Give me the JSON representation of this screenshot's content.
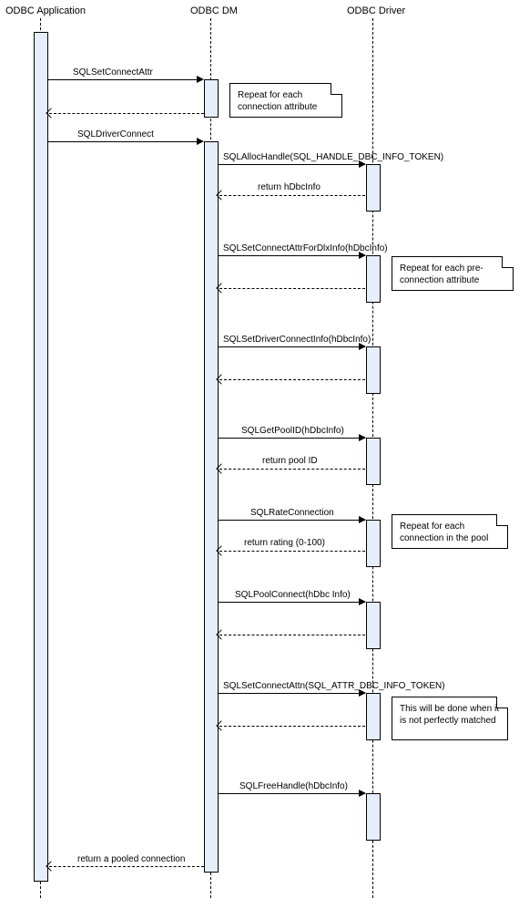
{
  "chart_data": {
    "type": "sequence_diagram",
    "participants": [
      "ODBC Application",
      "ODBC DM",
      "ODBC Driver"
    ],
    "messages": [
      {
        "from": "ODBC Application",
        "to": "ODBC DM",
        "label": "SQLSetConnectAttr",
        "kind": "sync",
        "note": "Repeat for each connection attribute"
      },
      {
        "from": "ODBC DM",
        "to": "ODBC Application",
        "label": "",
        "kind": "return"
      },
      {
        "from": "ODBC Application",
        "to": "ODBC DM",
        "label": "SQLDriverConnect",
        "kind": "sync"
      },
      {
        "from": "ODBC DM",
        "to": "ODBC Driver",
        "label": "SQLAllocHandle(SQL_HANDLE_DBC_INFO_TOKEN)",
        "kind": "sync"
      },
      {
        "from": "ODBC Driver",
        "to": "ODBC DM",
        "label": "return hDbcInfo",
        "kind": "return"
      },
      {
        "from": "ODBC DM",
        "to": "ODBC Driver",
        "label": "SQLSetConnectAttrForDlxInfo(hDbcInfo)",
        "kind": "sync",
        "note": "Repeat for each pre- connection attribute"
      },
      {
        "from": "ODBC Driver",
        "to": "ODBC DM",
        "label": "",
        "kind": "return"
      },
      {
        "from": "ODBC DM",
        "to": "ODBC Driver",
        "label": "SQLSetDriverConnectInfo(hDbcInfo)",
        "kind": "sync"
      },
      {
        "from": "ODBC Driver",
        "to": "ODBC DM",
        "label": "",
        "kind": "return"
      },
      {
        "from": "ODBC DM",
        "to": "ODBC Driver",
        "label": "SQLGetPoolID(hDbcInfo)",
        "kind": "sync"
      },
      {
        "from": "ODBC Driver",
        "to": "ODBC DM",
        "label": "return pool ID",
        "kind": "return"
      },
      {
        "from": "ODBC DM",
        "to": "ODBC Driver",
        "label": "SQLRateConnection",
        "kind": "sync",
        "note": "Repeat for each connection in the pool"
      },
      {
        "from": "ODBC Driver",
        "to": "ODBC DM",
        "label": "return rating (0-100)",
        "kind": "return"
      },
      {
        "from": "ODBC DM",
        "to": "ODBC Driver",
        "label": "SQLPoolConnect(hDbc Info)",
        "kind": "sync"
      },
      {
        "from": "ODBC Driver",
        "to": "ODBC DM",
        "label": "",
        "kind": "return"
      },
      {
        "from": "ODBC DM",
        "to": "ODBC Driver",
        "label": "SQLSetConnectAttn(SQL_ATTR_DBC_INFO_TOKEN)",
        "kind": "sync",
        "note": "This will be done when it is not perfectly matched"
      },
      {
        "from": "ODBC Driver",
        "to": "ODBC DM",
        "label": "",
        "kind": "return"
      },
      {
        "from": "ODBC DM",
        "to": "ODBC Driver",
        "label": "SQLFreeHandle(hDbcInfo)",
        "kind": "sync"
      },
      {
        "from": "ODBC DM",
        "to": "ODBC Application",
        "label": "return a pooled connection",
        "kind": "return"
      }
    ]
  },
  "participants": {
    "p0": "ODBC Application",
    "p1": "ODBC DM",
    "p2": "ODBC Driver"
  },
  "labels": {
    "m0": "SQLSetConnectAttr",
    "m1": "SQLDriverConnect",
    "m2": "SQLAllocHandle(SQL_HANDLE_DBC_INFO_TOKEN)",
    "m3": "return hDbcInfo",
    "m4": "SQLSetConnectAttrForDlxInfo(hDbcInfo)",
    "m5": "SQLSetDriverConnectInfo(hDbcInfo)",
    "m6": "SQLGetPoolID(hDbcInfo)",
    "m7": "return pool ID",
    "m8": "SQLRateConnection",
    "m9": "return rating (0-100)",
    "m10": "SQLPoolConnect(hDbc Info)",
    "m11": "SQLSetConnectAttn(SQL_ATTR_DBC_INFO_TOKEN)",
    "m12": "SQLFreeHandle(hDbcInfo)",
    "m13": "return a pooled connection"
  },
  "notes": {
    "n0": "Repeat for each connection attribute",
    "n1": "Repeat for each pre- connection attribute",
    "n2": "Repeat for each connection in the pool",
    "n3": "This will be done when it is not perfectly matched"
  }
}
